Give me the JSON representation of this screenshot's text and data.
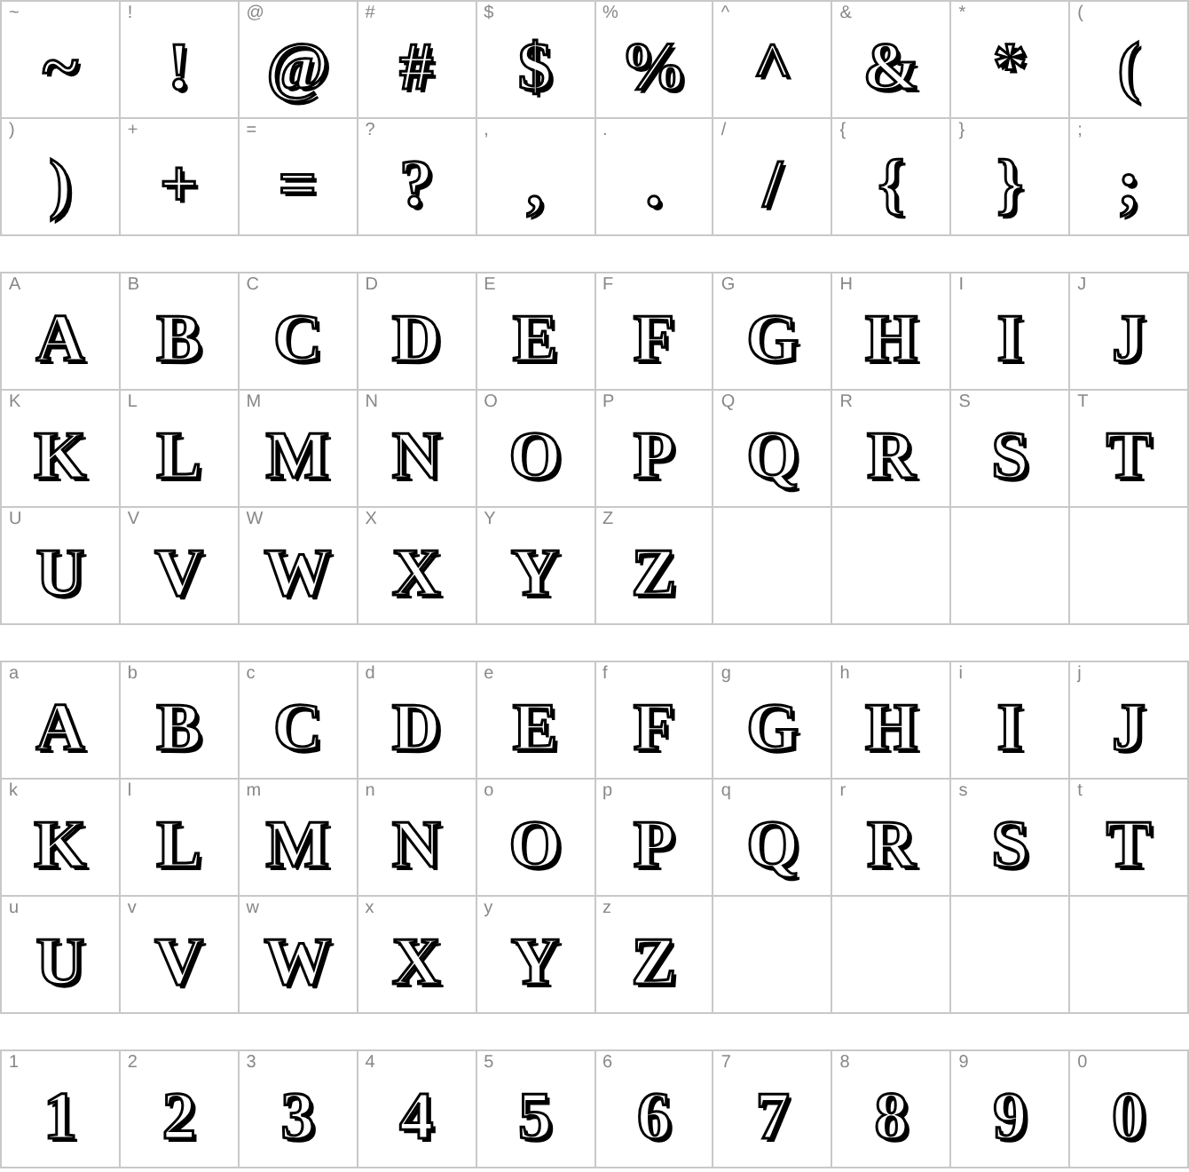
{
  "sections": [
    {
      "cells": [
        {
          "label": "~",
          "glyph": "~"
        },
        {
          "label": "!",
          "glyph": "!"
        },
        {
          "label": "@",
          "glyph": "@"
        },
        {
          "label": "#",
          "glyph": "#"
        },
        {
          "label": "$",
          "glyph": "$"
        },
        {
          "label": "%",
          "glyph": "%"
        },
        {
          "label": "^",
          "glyph": "^"
        },
        {
          "label": "&",
          "glyph": "&"
        },
        {
          "label": "*",
          "glyph": "*"
        },
        {
          "label": "(",
          "glyph": "("
        },
        {
          "label": ")",
          "glyph": ")"
        },
        {
          "label": "+",
          "glyph": "+"
        },
        {
          "label": "=",
          "glyph": "="
        },
        {
          "label": "?",
          "glyph": "?"
        },
        {
          "label": ",",
          "glyph": ","
        },
        {
          "label": ".",
          "glyph": "."
        },
        {
          "label": "/",
          "glyph": "/"
        },
        {
          "label": "{",
          "glyph": "{"
        },
        {
          "label": "}",
          "glyph": "}"
        },
        {
          "label": ";",
          "glyph": ";"
        }
      ]
    },
    {
      "cells": [
        {
          "label": "A",
          "glyph": "A"
        },
        {
          "label": "B",
          "glyph": "B"
        },
        {
          "label": "C",
          "glyph": "C"
        },
        {
          "label": "D",
          "glyph": "D"
        },
        {
          "label": "E",
          "glyph": "E"
        },
        {
          "label": "F",
          "glyph": "F"
        },
        {
          "label": "G",
          "glyph": "G"
        },
        {
          "label": "H",
          "glyph": "H"
        },
        {
          "label": "I",
          "glyph": "I"
        },
        {
          "label": "J",
          "glyph": "J"
        },
        {
          "label": "K",
          "glyph": "K"
        },
        {
          "label": "L",
          "glyph": "L"
        },
        {
          "label": "M",
          "glyph": "M"
        },
        {
          "label": "N",
          "glyph": "N"
        },
        {
          "label": "O",
          "glyph": "O"
        },
        {
          "label": "P",
          "glyph": "P"
        },
        {
          "label": "Q",
          "glyph": "Q"
        },
        {
          "label": "R",
          "glyph": "R"
        },
        {
          "label": "S",
          "glyph": "S"
        },
        {
          "label": "T",
          "glyph": "T"
        },
        {
          "label": "U",
          "glyph": "U"
        },
        {
          "label": "V",
          "glyph": "V"
        },
        {
          "label": "W",
          "glyph": "W"
        },
        {
          "label": "X",
          "glyph": "X"
        },
        {
          "label": "Y",
          "glyph": "Y"
        },
        {
          "label": "Z",
          "glyph": "Z"
        }
      ]
    },
    {
      "cells": [
        {
          "label": "a",
          "glyph": "A"
        },
        {
          "label": "b",
          "glyph": "B"
        },
        {
          "label": "c",
          "glyph": "C"
        },
        {
          "label": "d",
          "glyph": "D"
        },
        {
          "label": "e",
          "glyph": "E"
        },
        {
          "label": "f",
          "glyph": "F"
        },
        {
          "label": "g",
          "glyph": "G"
        },
        {
          "label": "h",
          "glyph": "H"
        },
        {
          "label": "i",
          "glyph": "I"
        },
        {
          "label": "j",
          "glyph": "J"
        },
        {
          "label": "k",
          "glyph": "K"
        },
        {
          "label": "l",
          "glyph": "L"
        },
        {
          "label": "m",
          "glyph": "M"
        },
        {
          "label": "n",
          "glyph": "N"
        },
        {
          "label": "o",
          "glyph": "O"
        },
        {
          "label": "p",
          "glyph": "P"
        },
        {
          "label": "q",
          "glyph": "Q"
        },
        {
          "label": "r",
          "glyph": "R"
        },
        {
          "label": "s",
          "glyph": "S"
        },
        {
          "label": "t",
          "glyph": "T"
        },
        {
          "label": "u",
          "glyph": "U"
        },
        {
          "label": "v",
          "glyph": "V"
        },
        {
          "label": "w",
          "glyph": "W"
        },
        {
          "label": "x",
          "glyph": "X"
        },
        {
          "label": "y",
          "glyph": "Y"
        },
        {
          "label": "z",
          "glyph": "Z"
        }
      ]
    },
    {
      "cells": [
        {
          "label": "1",
          "glyph": "1"
        },
        {
          "label": "2",
          "glyph": "2"
        },
        {
          "label": "3",
          "glyph": "3"
        },
        {
          "label": "4",
          "glyph": "4"
        },
        {
          "label": "5",
          "glyph": "5"
        },
        {
          "label": "6",
          "glyph": "6"
        },
        {
          "label": "7",
          "glyph": "7"
        },
        {
          "label": "8",
          "glyph": "8"
        },
        {
          "label": "9",
          "glyph": "9"
        },
        {
          "label": "0",
          "glyph": "0"
        }
      ]
    }
  ]
}
